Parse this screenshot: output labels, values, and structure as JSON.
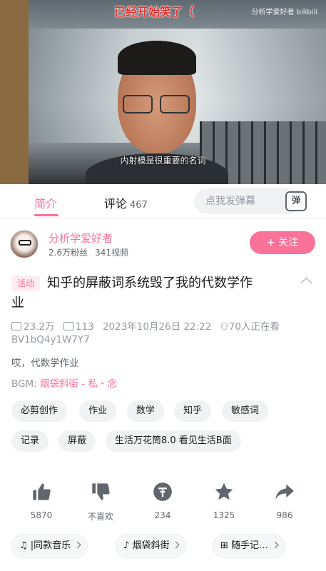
{
  "video": {
    "danmaku": "已经开始笑了（",
    "watermark": "分析学爱好者 bilibili",
    "subtitle": "内射模是很重要的名词"
  },
  "tabs": {
    "intro": "简介",
    "comment": "评论",
    "comment_count": "467",
    "danmaku_placeholder": "点我发弹幕",
    "danmaku_toggle": "弹"
  },
  "uploader": {
    "name": "分析学爱好者",
    "fans": "2.6万粉丝",
    "videos": "341视频",
    "follow_label": "+ 关注"
  },
  "video_info": {
    "event_tag": "活动",
    "title_line1": "知乎的屏蔽词系统毁了我的代数学作",
    "title_line2": "业",
    "views": "23.2万",
    "danmaku_count": "113",
    "date": "2023年10月26日 22:22",
    "watching": "70人正在看",
    "bvid": "BV1bQ4y1W7Y7",
    "description": "哎，代数学作业",
    "bgm_label": "BGM:",
    "bgm_song": "烟袋斜街 - 私・念"
  },
  "tags": [
    "必剪创作",
    "作业",
    "数学",
    "知乎",
    "敏感词",
    "记录",
    "屏蔽",
    "生活万花筒8.0 看见生活B面"
  ],
  "actions": [
    {
      "icon": "thumb-up-icon",
      "count": "5870"
    },
    {
      "icon": "thumb-down-icon",
      "count": "不喜欢"
    },
    {
      "icon": "coin-icon",
      "count": "234"
    },
    {
      "icon": "star-icon",
      "count": "1325"
    },
    {
      "icon": "share-icon",
      "count": "986"
    }
  ],
  "chips": [
    "|同款音乐",
    "烟袋斜街",
    "随手记…"
  ],
  "colors": {
    "accent": "#fb7299",
    "text": "#18191c",
    "muted": "#9499a0"
  }
}
